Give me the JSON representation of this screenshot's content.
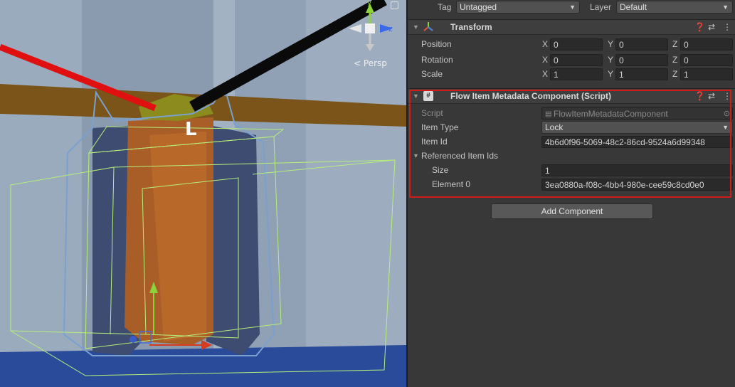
{
  "scene_view": {
    "projection_label": "Persp",
    "gizmo_axes": {
      "y": "y",
      "z": "z"
    },
    "object_label": "L"
  },
  "inspector": {
    "tag_label": "Tag",
    "tag_value": "Untagged",
    "layer_label": "Layer",
    "layer_value": "Default",
    "transform": {
      "title": "Transform",
      "rows": [
        {
          "label": "Position",
          "x": "0",
          "y": "0",
          "z": "0"
        },
        {
          "label": "Rotation",
          "x": "0",
          "y": "0",
          "z": "0"
        },
        {
          "label": "Scale",
          "x": "1",
          "y": "1",
          "z": "1"
        }
      ],
      "axis_x": "X",
      "axis_y": "Y",
      "axis_z": "Z"
    },
    "script_component": {
      "title": "Flow Item Metadata Component (Script)",
      "script_label": "Script",
      "script_value": "FlowItemMetadataComponent",
      "item_type_label": "Item Type",
      "item_type_value": "Lock",
      "item_id_label": "Item Id",
      "item_id_value": "4b6d0f96-5069-48c2-86cd-9524a6d99348",
      "referenced_label": "Referenced Item Ids",
      "size_label": "Size",
      "size_value": "1",
      "element0_label": "Element 0",
      "element0_value": "3ea0880a-f08c-4bb4-980e-cee59c8cd0e0"
    },
    "add_component_label": "Add Component"
  },
  "icons": [
    "settings-icon",
    "help-icon",
    "presets-icon",
    "more-icon",
    "transform-axes-icon",
    "script-icon",
    "lock-icon",
    "object-picker-icon"
  ],
  "colors": {
    "highlight": "#d11a1a",
    "panel": "#383838",
    "field": "#2a2a2a"
  }
}
